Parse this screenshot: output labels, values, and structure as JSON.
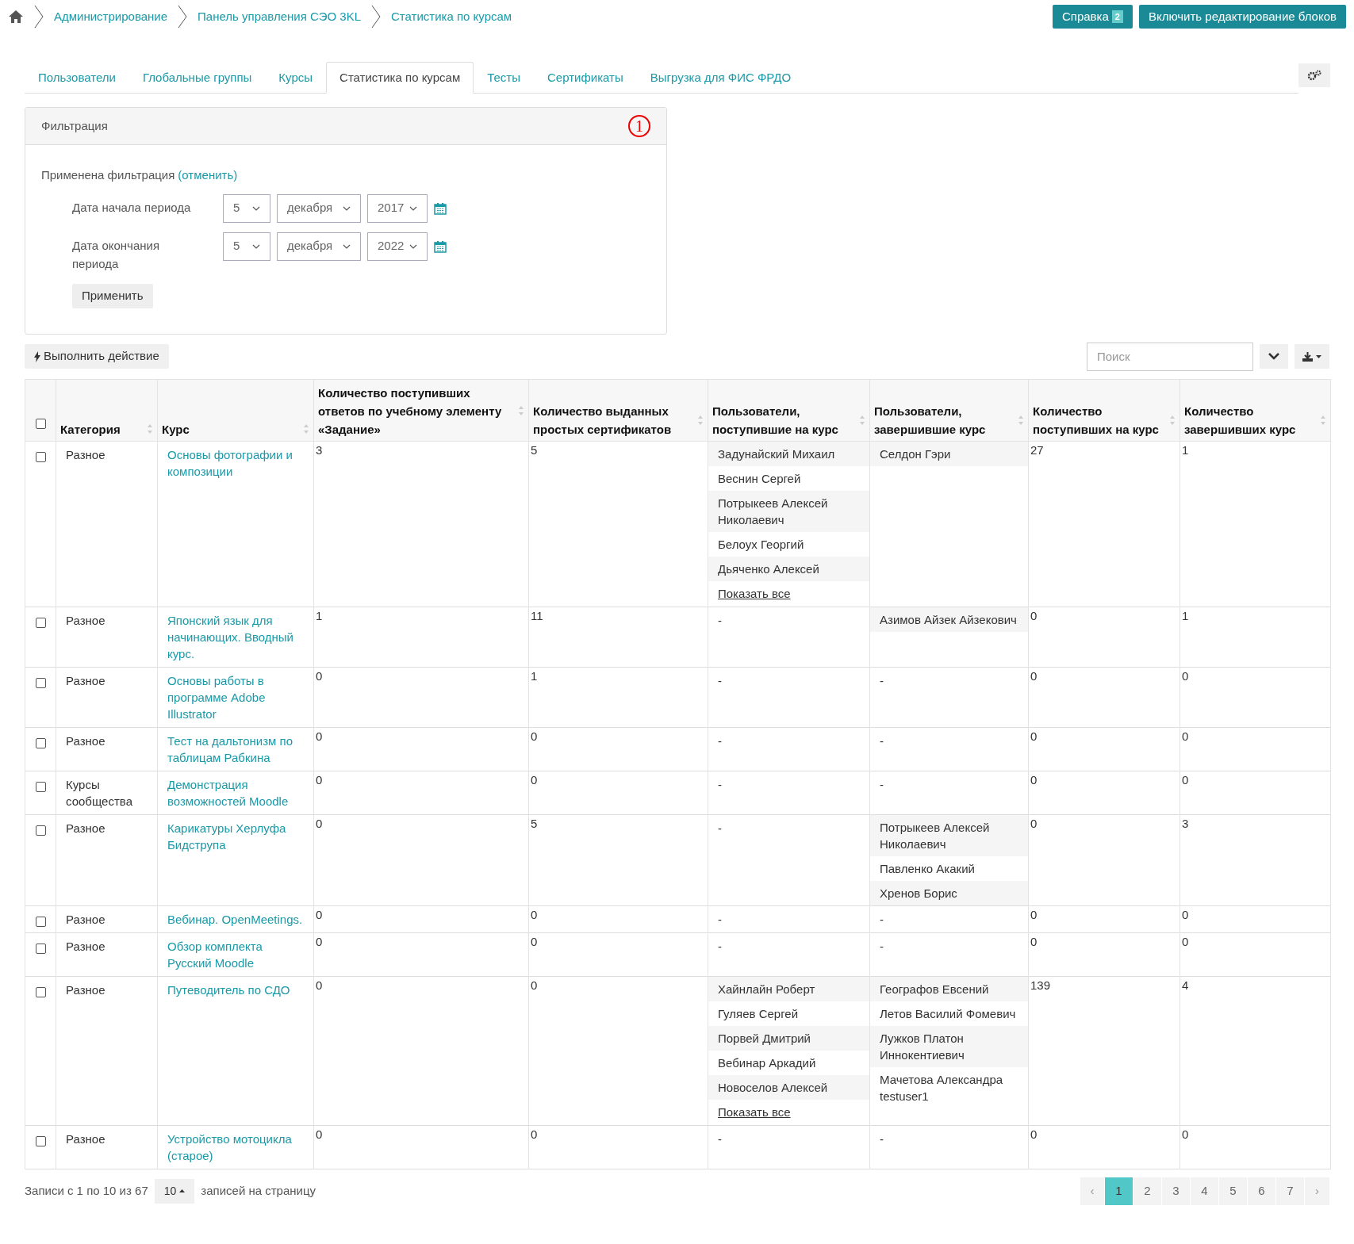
{
  "breadcrumbs": [
    "Администрирование",
    "Панель управления СЭО 3KL",
    "Статистика по курсам"
  ],
  "header_buttons": {
    "help": {
      "label": "Справка",
      "badge": "2"
    },
    "edit": "Включить редактирование блоков"
  },
  "tabs": [
    {
      "label": "Пользователи",
      "selected": false
    },
    {
      "label": "Глобальные группы",
      "selected": false
    },
    {
      "label": "Курсы",
      "selected": false
    },
    {
      "label": "Статистика по курсам",
      "selected": true
    },
    {
      "label": "Тесты",
      "selected": false
    },
    {
      "label": "Сертификаты",
      "selected": false
    },
    {
      "label": "Выгрузка для ФИС ФРДО",
      "selected": false
    }
  ],
  "filter": {
    "title": "Фильтрация",
    "marker": "1",
    "applied": "Применена фильтрация",
    "cancel": "(отменить)",
    "rows": [
      {
        "label": "Дата начала периода",
        "day": "5",
        "month": "декабря",
        "year": "2017"
      },
      {
        "label": "Дата окончания периода",
        "day": "5",
        "month": "декабря",
        "year": "2022"
      }
    ],
    "apply": "Применить"
  },
  "action_button": "Выполнить действие",
  "search": {
    "placeholder": "Поиск"
  },
  "table": {
    "columns": [
      "Категория",
      "Курс",
      "Количество поступивших ответов по учебному элементу «Задание»",
      "Количество выданных простых сертификатов",
      "Пользователи, поступившие на курс",
      "Пользователи, завершившие курс",
      "Количество поступивших на курс",
      "Количество завершивших курс"
    ],
    "select_all": false,
    "rows": [
      {
        "checked": false,
        "category": "Разное",
        "course": "Основы фотографии и композиции",
        "answers": "3",
        "certs": "5",
        "enrolled_users": [
          "Задунайский Михаил",
          "Веснин Сергей",
          "Потрыкеев Алексей Николаевич",
          "Белоух Георгий",
          "Дьяченко Алексей"
        ],
        "show_all": "Показать все",
        "completed_users": [
          "Селдон Гэри"
        ],
        "enrolled_count": "27",
        "completed_count": "1"
      },
      {
        "checked": false,
        "category": "Разное",
        "course": "Японский язык для начинающих. Вводный курс.",
        "answers": "1",
        "certs": "11",
        "enrolled": "-",
        "completed_users": [
          "Азимов Айзек Айзекович"
        ],
        "enrolled_count": "0",
        "completed_count": "1"
      },
      {
        "checked": false,
        "category": "Разное",
        "course": "Основы работы в программе Adobe Illustrator",
        "answers": "0",
        "certs": "1",
        "enrolled": "-",
        "completed": "-",
        "enrolled_count": "0",
        "completed_count": "0"
      },
      {
        "checked": false,
        "category": "Разное",
        "course": "Тест на дальтонизм по таблицам Рабкина",
        "answers": "0",
        "certs": "0",
        "enrolled": "-",
        "completed": "-",
        "enrolled_count": "0",
        "completed_count": "0"
      },
      {
        "checked": false,
        "category": "Курсы сообщества",
        "course": "Демонстрация возможностей Moodle",
        "answers": "0",
        "certs": "0",
        "enrolled": "-",
        "completed": "-",
        "enrolled_count": "0",
        "completed_count": "0"
      },
      {
        "checked": false,
        "category": "Разное",
        "course": "Карикатуры Херлуфа Бидструпа",
        "answers": "0",
        "certs": "5",
        "enrolled": "-",
        "completed_users": [
          "Потрыкеев Алексей Николаевич",
          "Павленко Акакий",
          "Хренов Борис"
        ],
        "enrolled_count": "0",
        "completed_count": "3"
      },
      {
        "checked": false,
        "category": "Разное",
        "course": "Вебинар. OpenMeetings.",
        "answers": "0",
        "certs": "0",
        "enrolled": "-",
        "completed": "-",
        "enrolled_count": "0",
        "completed_count": "0"
      },
      {
        "checked": false,
        "category": "Разное",
        "course": "Обзор комплекта Русский Moodle",
        "answers": "0",
        "certs": "0",
        "enrolled": "-",
        "completed": "-",
        "enrolled_count": "0",
        "completed_count": "0"
      },
      {
        "checked": false,
        "category": "Разное",
        "course": "Путеводитель по СДО",
        "answers": "0",
        "certs": "0",
        "enrolled_users": [
          "Хайнлайн Роберт",
          "Гуляев Сергей",
          "Порвей Дмитрий",
          "Вебинар Аркадий",
          "Новоселов Алексей"
        ],
        "show_all": "Показать все",
        "completed_users": [
          "Географов Евсений",
          "Летов Василий Фомевич",
          "Лужков Платон Иннокентиевич",
          "Мачетова Александра testuser1"
        ],
        "enrolled_count": "139",
        "completed_count": "4"
      },
      {
        "checked": false,
        "category": "Разное",
        "course": "Устройство мотоцикла (старое)",
        "answers": "0",
        "certs": "0",
        "enrolled": "-",
        "completed": "-",
        "enrolled_count": "0",
        "completed_count": "0"
      }
    ]
  },
  "footer": {
    "records": "Записи с 1 по 10 из 67",
    "per_page": "10",
    "per_page_label": "записей на страницу",
    "prev": "‹",
    "next": "›",
    "pages": [
      {
        "label": "1",
        "selected": true
      },
      {
        "label": "2",
        "selected": false
      },
      {
        "label": "3",
        "selected": false
      },
      {
        "label": "4",
        "selected": false
      },
      {
        "label": "5",
        "selected": false
      },
      {
        "label": "6",
        "selected": false
      },
      {
        "label": "7",
        "selected": false
      }
    ]
  }
}
